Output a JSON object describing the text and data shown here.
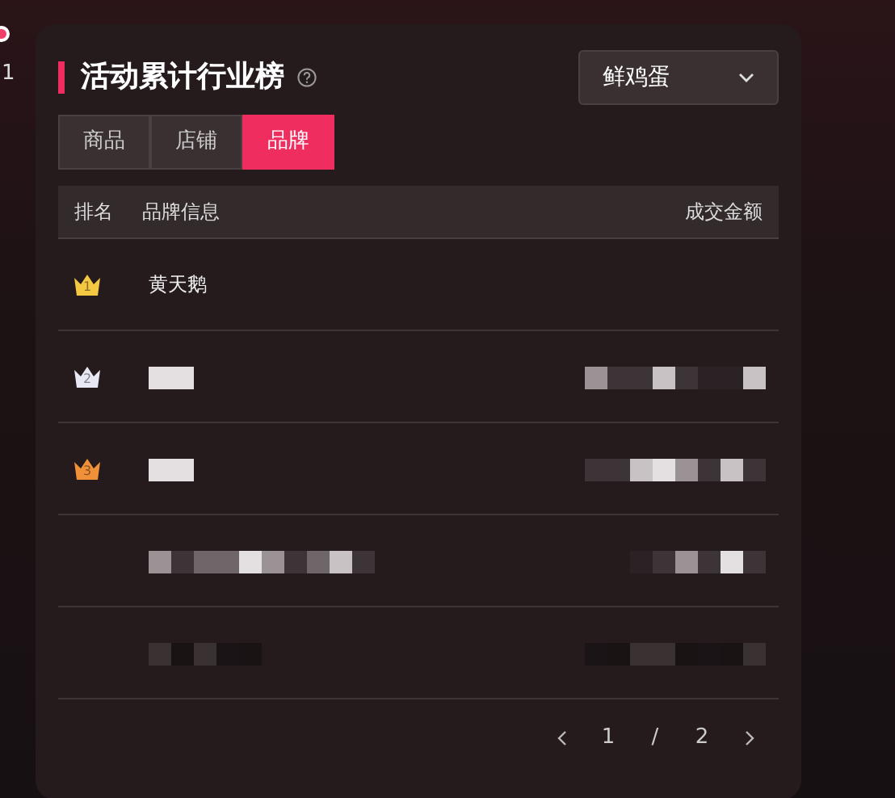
{
  "side_badge": {
    "text": "1"
  },
  "title": "活动累计行业榜",
  "dropdown": {
    "value": "鲜鸡蛋"
  },
  "tabs": [
    {
      "label": "商品",
      "selected": false
    },
    {
      "label": "店铺",
      "selected": false
    },
    {
      "label": "品牌",
      "selected": true
    }
  ],
  "table": {
    "columns": [
      "排名",
      "品牌信息",
      "成交金额"
    ],
    "rows": [
      {
        "rank": "1",
        "color": "#f5c842",
        "name": "黄天鹅",
        "kind": "named"
      },
      {
        "rank": "2",
        "color": "#e8e8f4",
        "kind": "mosaic"
      },
      {
        "rank": "3",
        "color": "#f0913a",
        "kind": "mosaic"
      },
      {
        "kind": "mosaic"
      },
      {
        "kind": "mosaic"
      }
    ]
  },
  "pagination": {
    "current": "1",
    "separator": "/",
    "total": "2"
  }
}
